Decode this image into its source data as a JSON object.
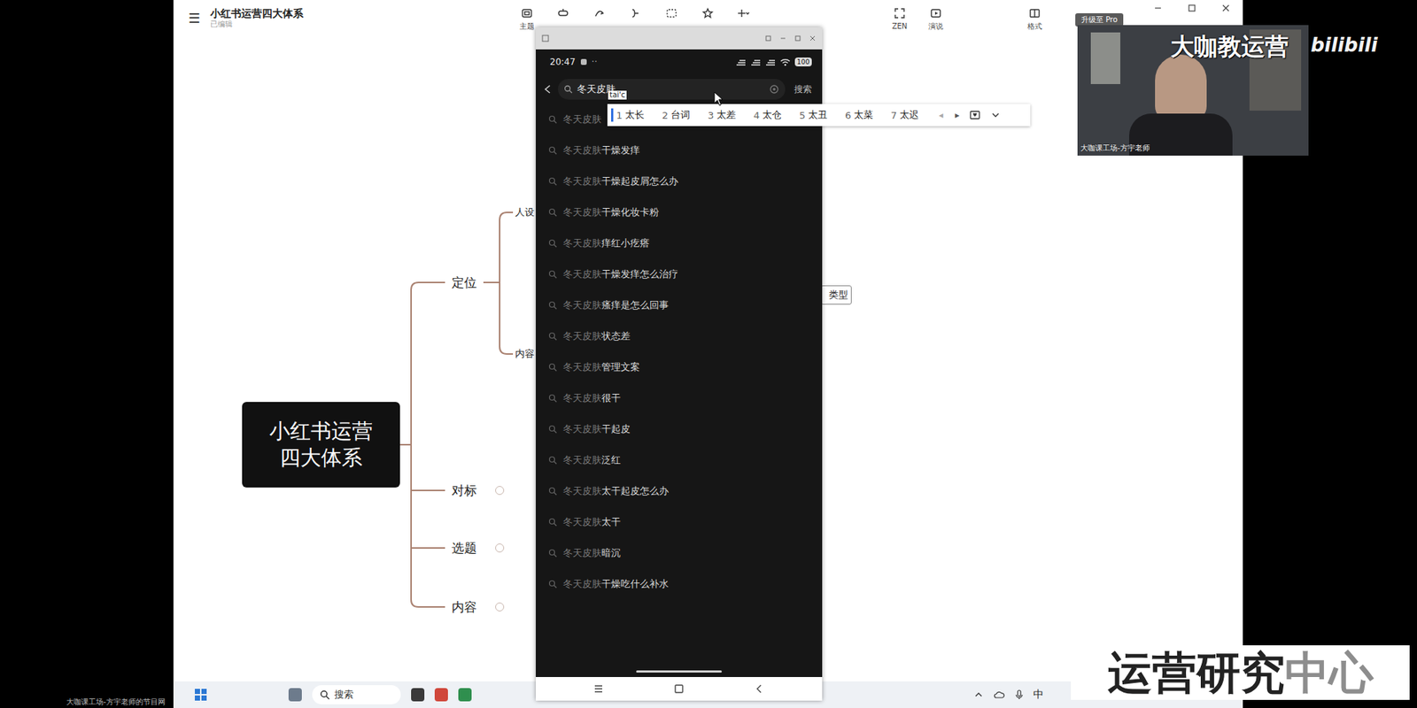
{
  "window": {
    "menu_icon": "☰",
    "title": "小红书运营四大体系",
    "subtitle": "已编辑",
    "upgrade": "升级至 Pro"
  },
  "toolbar": {
    "left": [
      {
        "kind": "theme",
        "label": "主题"
      },
      {
        "kind": "insert"
      },
      {
        "kind": "relation"
      },
      {
        "kind": "summary"
      },
      {
        "kind": "boundary"
      },
      {
        "kind": "star"
      },
      {
        "kind": "add"
      }
    ],
    "right": [
      {
        "kind": "zen",
        "label": "ZEN"
      },
      {
        "kind": "present",
        "label": "演说"
      },
      {
        "kind": "format",
        "label": "格式"
      }
    ]
  },
  "mindmap": {
    "root": [
      "小红书运营",
      "四大体系"
    ],
    "branches": [
      {
        "label": "定位",
        "expanded": true,
        "children": [
          {
            "label": "人设"
          },
          {
            "label": "内容"
          }
        ]
      },
      {
        "label": "对标",
        "expanded": false
      },
      {
        "label": "选题",
        "expanded": false
      },
      {
        "label": "内容",
        "expanded": false
      }
    ],
    "tag": "类型"
  },
  "phone": {
    "time": "20:47",
    "dots": "··",
    "battery": "100",
    "query": "冬天皮肤",
    "composition": "tai'c",
    "search_button": "搜索",
    "suggestions": [
      {
        "prefix": "冬天皮肤"
      },
      {
        "prefix": "冬天皮肤",
        "suffix": "干燥发痒"
      },
      {
        "prefix": "冬天皮肤",
        "suffix": "干燥起皮屑怎么办"
      },
      {
        "prefix": "冬天皮肤",
        "suffix": "干燥化妆卡粉"
      },
      {
        "prefix": "冬天皮肤",
        "suffix": "痒红小疙瘩"
      },
      {
        "prefix": "冬天皮肤",
        "suffix": "干燥发痒怎么治疗"
      },
      {
        "prefix": "冬天皮肤",
        "suffix": "瘙痒是怎么回事"
      },
      {
        "prefix": "冬天皮肤",
        "suffix": "状态差"
      },
      {
        "prefix": "冬天皮肤",
        "suffix": "管理文案"
      },
      {
        "prefix": "冬天皮肤",
        "suffix": "很干"
      },
      {
        "prefix": "冬天皮肤",
        "suffix": "干起皮"
      },
      {
        "prefix": "冬天皮肤",
        "suffix": "泛红"
      },
      {
        "prefix": "冬天皮肤",
        "suffix": "太干起皮怎么办"
      },
      {
        "prefix": "冬天皮肤",
        "suffix": "太干"
      },
      {
        "prefix": "冬天皮肤",
        "suffix": "暗沉"
      },
      {
        "prefix": "冬天皮肤",
        "suffix": "干燥吃什么补水"
      }
    ]
  },
  "ime": {
    "candidates": [
      {
        "index": "1",
        "word": "太长",
        "selected": true
      },
      {
        "index": "2",
        "word": "台词",
        "selected": false
      },
      {
        "index": "3",
        "word": "太差",
        "selected": false
      },
      {
        "index": "4",
        "word": "太仓",
        "selected": false
      },
      {
        "index": "5",
        "word": "太丑",
        "selected": false
      },
      {
        "index": "6",
        "word": "太菜",
        "selected": false
      },
      {
        "index": "7",
        "word": "太迟",
        "selected": false
      }
    ],
    "prev": "◂",
    "next": "▸"
  },
  "taskbar": {
    "search": "搜索",
    "ime": "中"
  },
  "webcam": {
    "caption": "大咖课工场-方宇老师"
  },
  "overlay": {
    "watermark": "大咖教运营",
    "logo": "bilibili",
    "brand_main": "运营研究",
    "brand_accent": "中心",
    "footer": "大咖课工场-方宇老师的节目网"
  }
}
